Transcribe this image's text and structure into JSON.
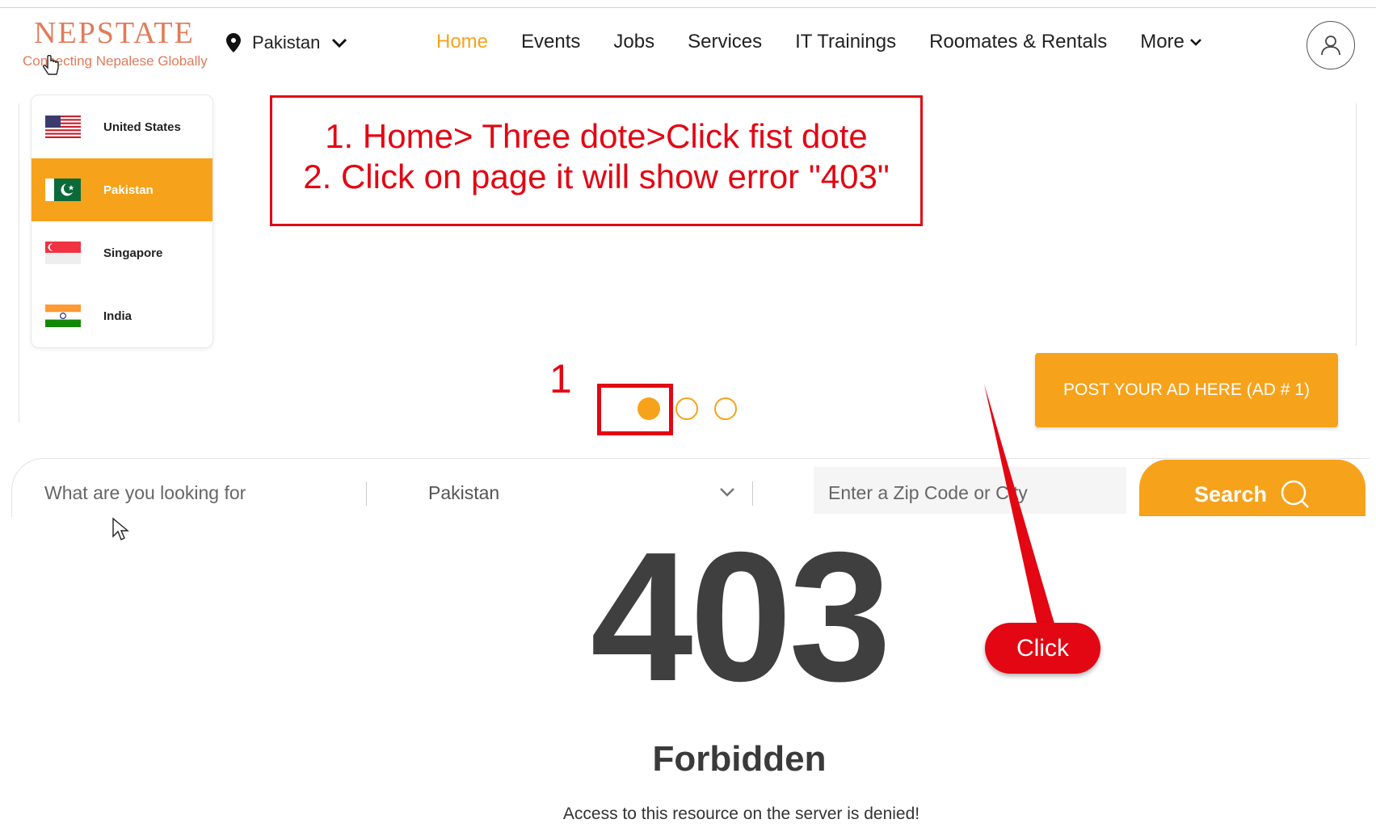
{
  "header": {
    "logo_title": "NEPSTATE",
    "logo_tagline": "Connecting Nepalese Globally",
    "location": "Pakistan",
    "nav": [
      {
        "label": "Home",
        "active": true
      },
      {
        "label": "Events"
      },
      {
        "label": "Jobs"
      },
      {
        "label": "Services"
      },
      {
        "label": "IT Trainings"
      },
      {
        "label": "Roomates & Rentals"
      }
    ],
    "more_label": "More"
  },
  "countries": [
    {
      "name": "United States",
      "flag": "us-flag-icon"
    },
    {
      "name": "Pakistan",
      "flag": "pk-flag-icon",
      "selected": true
    },
    {
      "name": "Singapore",
      "flag": "sg-flag-icon"
    },
    {
      "name": "India",
      "flag": "in-flag-icon"
    }
  ],
  "annotation": {
    "line1": "1. Home> Three dote>Click fist dote",
    "line2": "2. Click on page it will show error \"403\"",
    "marker": "1",
    "click_label": "Click",
    "color": "#e30613"
  },
  "carousel": {
    "dots": 3,
    "active_index": 0
  },
  "post_ad_label": "POST YOUR AD HERE (AD # 1)",
  "search": {
    "query_placeholder": "What are you looking for",
    "country": "Pakistan",
    "zip_placeholder": "Enter a Zip Code or City",
    "button_label": "Search"
  },
  "error": {
    "code": "403",
    "title": "Forbidden",
    "message": "Access to this resource on the server is denied!"
  },
  "colors": {
    "accent": "#f7a21b",
    "logo": "#e07b5a"
  }
}
